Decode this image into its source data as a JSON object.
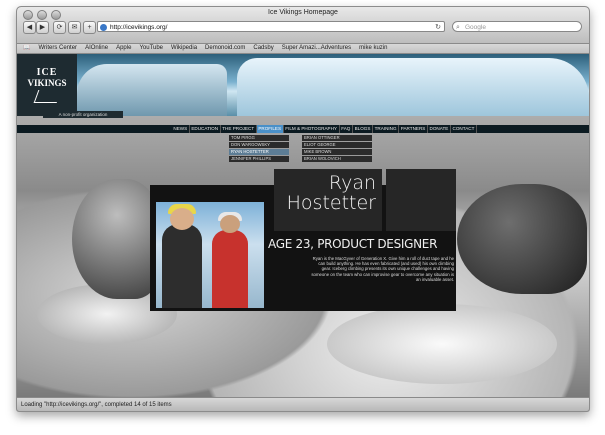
{
  "window": {
    "title": "Ice Vikings Homepage"
  },
  "toolbar": {
    "back": "◀",
    "forward": "▶",
    "reload": "⟳",
    "bookmark": "✉",
    "add": "+",
    "address": "http://icevikings.org/",
    "search_placeholder": "Google"
  },
  "bookmarks": [
    "Writers Center",
    "AIOnline",
    "Apple",
    "YouTube",
    "Wikipedia",
    "Demonoid.com",
    "Cadsby",
    "Super Amazi...Adventures",
    "mike kuzin"
  ],
  "site": {
    "logo_line1": "ICE",
    "logo_line2": "VIKINGS",
    "tagline": "A non-profit organization",
    "nav": [
      "NEWS",
      "EDUCATION",
      "THE PROJECT",
      "PROFILES",
      "FILM & PHOTOGRAPHY",
      "FAQ",
      "BLOGS",
      "TRAINING",
      "PARTNERS",
      "DONATE",
      "CONTACT"
    ],
    "active_nav": "PROFILES",
    "submenu_left": [
      "TOM PIRGG",
      "DON WARGOWSKY",
      "RYAN HOSTETTER",
      "JENNIFER PHILLIPS"
    ],
    "submenu_right": [
      "BRIAN OTTINGER",
      "ELIOT GEORGE",
      "MIKE BROWN",
      "BRIAN WOLOVICH"
    ],
    "highlight_sub": "RYAN HOSTETTER"
  },
  "profile": {
    "first_name": "Ryan",
    "last_name": "Hostetter",
    "role": "AGE 23, PRODUCT DESIGNER",
    "bio": "Ryan is the MacGyver of Generation X. Give him a roll of duct tape and he can build anything. He has even fabricated (and used) his own climbing gear. Iceberg climbing presents its own unique challenges and having someone on the team who can improvise gear to overcome any situation is an invaluable asset."
  },
  "status": {
    "text": "Loading \"http://icevikings.org/\", completed 14 of 15 items"
  },
  "colors": {
    "nav_bg": "#0c1b22",
    "nav_active": "#4a90c8",
    "panel": "#262626"
  }
}
